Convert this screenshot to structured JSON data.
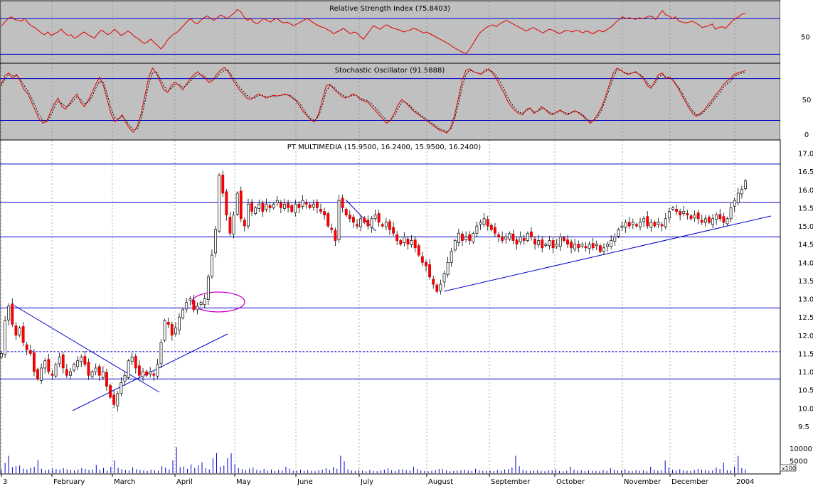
{
  "chart_data": [
    {
      "type": "line",
      "title": "Relative Strength Index (75.8403)",
      "y_ticks": [
        50
      ],
      "ylim": [
        20,
        90
      ],
      "reference_lines": [
        30,
        70
      ],
      "series": [
        {
          "values": [
            62,
            66,
            70,
            72,
            69,
            68,
            67,
            70,
            65,
            62,
            60,
            57,
            54,
            52,
            55,
            51,
            53,
            55,
            58,
            54,
            51,
            52,
            48,
            50,
            53,
            55,
            52,
            50,
            48,
            53,
            57,
            55,
            52,
            54,
            58,
            55,
            51,
            53,
            56,
            54,
            50,
            48,
            45,
            42,
            44,
            47,
            43,
            40,
            36,
            40,
            46,
            50,
            53,
            55,
            59,
            63,
            67,
            70,
            66,
            64,
            68,
            71,
            73,
            70,
            68,
            71,
            74,
            72,
            70,
            73,
            76,
            80,
            78,
            72,
            68,
            70,
            66,
            64,
            67,
            70,
            68,
            66,
            69,
            70,
            67,
            65,
            66,
            64,
            62,
            64,
            66,
            68,
            70,
            68,
            65,
            63,
            61,
            60,
            58,
            56,
            53,
            55,
            57,
            59,
            56,
            53,
            55,
            54,
            50,
            47,
            52,
            57,
            62,
            60,
            58,
            61,
            63,
            61,
            59,
            58,
            57,
            55,
            56,
            57,
            59,
            58,
            56,
            54,
            55,
            53,
            51,
            49,
            47,
            45,
            43,
            41,
            38,
            36,
            34,
            32,
            31,
            36,
            42,
            48,
            54,
            57,
            60,
            62,
            63,
            61,
            64,
            66,
            68,
            66,
            64,
            62,
            60,
            58,
            56,
            58,
            60,
            58,
            56,
            54,
            56,
            58,
            57,
            55,
            53,
            55,
            57,
            56,
            55,
            57,
            56,
            54,
            56,
            55,
            53,
            55,
            57,
            55,
            57,
            59,
            62,
            66,
            69,
            72,
            70,
            71,
            70,
            69,
            71,
            70,
            71,
            73,
            72,
            69,
            74,
            79,
            74,
            73,
            70,
            72,
            67,
            66,
            65,
            66,
            67,
            65,
            63,
            60,
            61,
            62,
            64,
            58,
            60,
            61,
            59,
            63,
            67,
            70,
            72,
            75,
            76
          ]
        }
      ]
    },
    {
      "type": "line",
      "title": "Stochastic Oscillator (91.5888)",
      "y_ticks": [
        0,
        50
      ],
      "ylim": [
        -8,
        102
      ],
      "reference_lines": [
        20,
        80
      ],
      "series": [
        {
          "values": [
            72,
            85,
            88,
            80,
            86,
            76,
            64,
            58,
            46,
            34,
            22,
            16,
            19,
            32,
            44,
            52,
            40,
            36,
            44,
            52,
            58,
            46,
            40,
            49,
            60,
            72,
            82,
            70,
            50,
            30,
            18,
            22,
            28,
            16,
            8,
            3,
            12,
            30,
            56,
            82,
            95,
            88,
            76,
            64,
            60,
            70,
            75,
            70,
            64,
            72,
            80,
            86,
            90,
            84,
            80,
            74,
            78,
            86,
            92,
            96,
            90,
            80,
            72,
            64,
            58,
            52,
            50,
            54,
            58,
            56,
            52,
            54,
            56,
            55,
            56,
            58,
            56,
            52,
            48,
            40,
            32,
            26,
            20,
            18,
            30,
            50,
            70,
            72,
            65,
            60,
            55,
            52,
            54,
            58,
            56,
            50,
            48,
            46,
            40,
            34,
            28,
            22,
            16,
            20,
            30,
            42,
            50,
            46,
            40,
            34,
            30,
            26,
            22,
            18,
            14,
            10,
            6,
            4,
            2,
            10,
            28,
            52,
            78,
            92,
            94,
            90,
            88,
            86,
            92,
            94,
            88,
            80,
            70,
            60,
            48,
            40,
            34,
            30,
            28,
            36,
            38,
            30,
            34,
            40,
            36,
            30,
            28,
            32,
            35,
            30,
            28,
            32,
            34,
            30,
            26,
            20,
            16,
            22,
            30,
            40,
            55,
            72,
            88,
            95,
            92,
            88,
            86,
            88,
            90,
            85,
            80,
            70,
            66,
            76,
            86,
            88,
            80,
            82,
            76,
            68,
            58,
            48,
            38,
            30,
            26,
            30,
            34,
            42,
            48,
            56,
            62,
            70,
            76,
            80,
            86,
            88,
            90,
            91.5888
          ]
        },
        {
          "values": [
            70,
            80,
            86,
            84,
            84,
            80,
            70,
            62,
            52,
            40,
            28,
            20,
            18,
            26,
            38,
            48,
            44,
            40,
            42,
            48,
            54,
            50,
            44,
            46,
            54,
            66,
            76,
            74,
            58,
            38,
            24,
            22,
            26,
            20,
            12,
            6,
            8,
            22,
            46,
            72,
            88,
            90,
            80,
            70,
            62,
            66,
            72,
            72,
            68,
            70,
            76,
            82,
            86,
            86,
            82,
            78,
            78,
            82,
            88,
            92,
            92,
            84,
            76,
            68,
            62,
            56,
            52,
            52,
            56,
            56,
            54,
            54,
            55,
            55,
            56,
            57,
            57,
            54,
            50,
            44,
            36,
            28,
            22,
            20,
            26,
            42,
            62,
            70,
            68,
            62,
            58,
            54,
            54,
            56,
            56,
            52,
            50,
            48,
            44,
            38,
            32,
            26,
            20,
            20,
            26,
            36,
            46,
            46,
            42,
            36,
            32,
            28,
            24,
            20,
            16,
            12,
            8,
            6,
            4,
            8,
            22,
            44,
            68,
            86,
            92,
            90,
            88,
            87,
            90,
            92,
            90,
            84,
            76,
            66,
            54,
            44,
            38,
            32,
            30,
            34,
            37,
            32,
            33,
            37,
            36,
            32,
            30,
            31,
            34,
            32,
            30,
            31,
            33,
            31,
            28,
            22,
            18,
            20,
            26,
            36,
            50,
            66,
            82,
            92,
            92,
            89,
            87,
            88,
            89,
            86,
            82,
            74,
            68,
            72,
            82,
            86,
            82,
            81,
            77,
            70,
            62,
            52,
            42,
            34,
            28,
            28,
            32,
            38,
            44,
            52,
            58,
            66,
            72,
            76,
            82,
            86,
            88,
            89
          ]
        }
      ]
    },
    {
      "type": "candlestick",
      "title": "PT MULTIMEDIA (15.9500, 16.2400, 15.9500, 16.2400)",
      "ylim": [
        9.25,
        17.2
      ],
      "y_ticks": [
        9.5,
        10.0,
        10.5,
        11.0,
        11.5,
        12.0,
        12.5,
        13.0,
        13.5,
        14.0,
        14.5,
        15.0,
        15.5,
        16.0,
        16.5,
        17.0
      ],
      "x_ticks": [
        "3",
        "February",
        "March",
        "April",
        "May",
        "June",
        "July",
        "August",
        "September",
        "October",
        "November",
        "December",
        "2004"
      ],
      "horizontal_levels": [
        16.7,
        15.65,
        14.7,
        12.75,
        10.8
      ],
      "dashed_level": 11.55,
      "closes": [
        11.5,
        12.4,
        12.8,
        12.3,
        12.0,
        12.2,
        11.8,
        11.6,
        11.5,
        11.0,
        10.8,
        11.1,
        11.3,
        11.0,
        10.9,
        11.2,
        11.4,
        11.1,
        10.9,
        11.0,
        11.2,
        11.3,
        11.4,
        11.2,
        10.9,
        11.0,
        11.1,
        10.9,
        11.0,
        10.6,
        10.3,
        10.1,
        10.4,
        10.7,
        10.9,
        11.3,
        11.4,
        11.1,
        10.9,
        11.0,
        10.9,
        11.0,
        10.9,
        11.2,
        11.8,
        12.4,
        12.3,
        12.0,
        12.2,
        12.5,
        12.7,
        12.9,
        13.0,
        12.7,
        12.8,
        12.9,
        13.0,
        13.6,
        14.2,
        14.9,
        16.4,
        15.9,
        15.3,
        14.8,
        15.3,
        15.9,
        15.2,
        15.0,
        15.6,
        15.4,
        15.5,
        15.6,
        15.4,
        15.6,
        15.5,
        15.6,
        15.7,
        15.5,
        15.6,
        15.5,
        15.4,
        15.6,
        15.5,
        15.7,
        15.6,
        15.5,
        15.6,
        15.5,
        15.4,
        15.3,
        15.0,
        14.9,
        14.6,
        15.7,
        15.5,
        15.3,
        15.2,
        15.1,
        15.0,
        15.2,
        15.1,
        15.0,
        15.2,
        15.3,
        15.1,
        15.0,
        15.1,
        14.9,
        14.8,
        14.6,
        14.5,
        14.7,
        14.5,
        14.6,
        14.4,
        14.2,
        14.0,
        13.9,
        13.6,
        13.4,
        13.2,
        13.4,
        13.7,
        14.0,
        14.3,
        14.6,
        14.8,
        14.6,
        14.7,
        14.6,
        14.8,
        15.0,
        15.1,
        15.2,
        15.0,
        14.9,
        14.8,
        14.7,
        14.6,
        14.7,
        14.8,
        14.6,
        14.5,
        14.7,
        14.6,
        14.8,
        14.7,
        14.5,
        14.6,
        14.4,
        14.5,
        14.6,
        14.4,
        14.5,
        14.7,
        14.6,
        14.5,
        14.4,
        14.5,
        14.4,
        14.5,
        14.4,
        14.5,
        14.4,
        14.5,
        14.3,
        14.4,
        14.5,
        14.6,
        14.7,
        14.9,
        15.0,
        15.1,
        15.0,
        15.1,
        15.0,
        15.1,
        15.2,
        15.0,
        15.1,
        15.0,
        15.1,
        15.0,
        15.2,
        15.4,
        15.5,
        15.4,
        15.3,
        15.4,
        15.3,
        15.2,
        15.3,
        15.2,
        15.1,
        15.2,
        15.1,
        15.2,
        15.3,
        15.2,
        15.1,
        15.2,
        15.5,
        15.7,
        15.9,
        16.0,
        16.24
      ]
    },
    {
      "type": "bar",
      "y_ticks": [
        5000,
        10000
      ],
      "ylim": [
        0,
        12000
      ],
      "unit_label": "x100",
      "values": [
        1500,
        4200,
        7000,
        2400,
        2800,
        3100,
        1800,
        1500,
        2100,
        2600,
        5200,
        1800,
        1200,
        1500,
        1900,
        1700,
        1400,
        2000,
        1600,
        1300,
        1100,
        1500,
        2000,
        1700,
        1300,
        1500,
        3300,
        1400,
        2100,
        1100,
        2600,
        5100,
        2200,
        1600,
        1300,
        1100,
        2400,
        1600,
        1300,
        1100,
        900,
        1400,
        1200,
        1000,
        2800,
        2300,
        1500,
        5100,
        10500,
        2500,
        2700,
        1800,
        3500,
        2100,
        3200,
        4400,
        2000,
        1500,
        6000,
        8100,
        2700,
        3100,
        6000,
        8000,
        3600,
        2000,
        1600,
        1200,
        1800,
        2300,
        1300,
        1100,
        1700,
        1000,
        1500,
        900,
        1300,
        1100,
        2600,
        1800,
        1000,
        1100,
        1400,
        900,
        1200,
        1000,
        800,
        1200,
        1500,
        2000,
        1300,
        2500,
        1800,
        7000,
        4800,
        1500,
        1100,
        900,
        1400,
        1000,
        800,
        1300,
        900,
        800,
        1100,
        1400,
        1900,
        1200,
        900,
        1500,
        1600,
        1200,
        1100,
        2600,
        1700,
        1100,
        900,
        800,
        1000,
        1200,
        1700,
        1600,
        1100,
        800,
        900,
        1100,
        1200,
        1400,
        1000,
        900,
        1800,
        1200,
        900,
        1000,
        1100,
        800,
        1200,
        1000,
        1500,
        1700,
        2300,
        7000,
        2800,
        1300,
        1000,
        900,
        1100,
        1200,
        900,
        800,
        1200,
        1100,
        1500,
        900,
        800,
        1000,
        2600,
        1400,
        1100,
        1200,
        900,
        1100,
        1000,
        900,
        800,
        1300,
        1000,
        2000,
        1400,
        1100,
        1200,
        1600,
        900,
        800,
        1200,
        1000,
        1100,
        900,
        2600,
        1300,
        1000,
        1200,
        5100,
        2300,
        1400,
        1100,
        1600,
        1200,
        1000,
        900,
        1300,
        1700,
        1400,
        1200,
        1000,
        1100,
        2300,
        1700,
        4200,
        1300,
        1100,
        2700,
        7000,
        2000,
        1500
      ]
    }
  ]
}
